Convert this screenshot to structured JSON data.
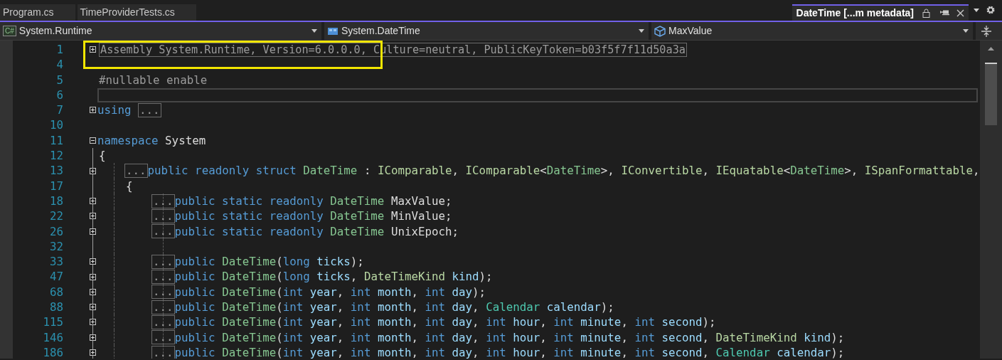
{
  "tabs": [
    {
      "label": "Program.cs",
      "selected": false,
      "kind": "document"
    },
    {
      "label": "TimeProviderTests.cs",
      "selected": false,
      "kind": "document"
    },
    {
      "label": "DateTime [...m metadata]",
      "selected": true,
      "kind": "preview"
    }
  ],
  "navigation": [
    {
      "label": "System.Runtime",
      "kind": "project",
      "badge": "C#"
    },
    {
      "label": "System.DateTime",
      "kind": "struct"
    },
    {
      "label": "MaxValue",
      "kind": "field"
    }
  ],
  "editor": {
    "lines": [
      {
        "number": "1",
        "expanded": false,
        "tokens": [
          {
            "kind": "collapsed",
            "text": "Assembly System.Runtime, Version=6.0.0.0, Culture=neutral, PublicKeyToken=b03f5f7f11d50a3a"
          }
        ]
      },
      {
        "number": "4"
      },
      {
        "number": "5",
        "tokens": [
          {
            "kind": "preproc",
            "text": "#nullable enable"
          }
        ]
      },
      {
        "number": "6",
        "current": true
      },
      {
        "number": "7",
        "expanded": false,
        "tokens": [
          {
            "kind": "kw",
            "text": "using "
          },
          {
            "kind": "collapsed",
            "text": "..."
          }
        ]
      },
      {
        "number": "10"
      },
      {
        "number": "11",
        "expanded": true,
        "tokens": [
          {
            "kind": "kw",
            "text": "namespace "
          },
          {
            "kind": "plain",
            "text": "System"
          }
        ]
      },
      {
        "number": "12",
        "tokens": [
          {
            "kind": "plain",
            "text": "{"
          }
        ],
        "children": [
          {
            "number": "13",
            "expanded": false,
            "tokens": [
              {
                "kind": "collapsed",
                "text": "..."
              },
              {
                "kind": "kw",
                "text": "public readonly struct "
              },
              {
                "kind": "struct",
                "text": "DateTime"
              },
              {
                "kind": "plain",
                "text": " : "
              },
              {
                "kind": "iface",
                "text": "IComparable"
              },
              {
                "kind": "plain",
                "text": ", "
              },
              {
                "kind": "iface",
                "text": "IComparable"
              },
              {
                "kind": "plain",
                "text": "<"
              },
              {
                "kind": "struct",
                "text": "DateTime"
              },
              {
                "kind": "plain",
                "text": ">, "
              },
              {
                "kind": "iface",
                "text": "IConvertible"
              },
              {
                "kind": "plain",
                "text": ", "
              },
              {
                "kind": "iface",
                "text": "IEquatable"
              },
              {
                "kind": "plain",
                "text": "<"
              },
              {
                "kind": "struct",
                "text": "DateTime"
              },
              {
                "kind": "plain",
                "text": ">, "
              },
              {
                "kind": "iface",
                "text": "ISpanFormattable"
              },
              {
                "kind": "plain",
                "text": ","
              }
            ]
          },
          {
            "number": "17",
            "tokens": [
              {
                "kind": "plain",
                "text": "{"
              }
            ],
            "children": [
              {
                "number": "18",
                "expanded": false,
                "tokens": [
                  {
                    "kind": "collapsed",
                    "text": "..."
                  },
                  {
                    "kind": "kw",
                    "text": "public static readonly "
                  },
                  {
                    "kind": "struct",
                    "text": "DateTime "
                  },
                  {
                    "kind": "member",
                    "text": "MaxValue;"
                  }
                ]
              },
              {
                "number": "22",
                "expanded": false,
                "tokens": [
                  {
                    "kind": "collapsed",
                    "text": "..."
                  },
                  {
                    "kind": "kw",
                    "text": "public static readonly "
                  },
                  {
                    "kind": "struct",
                    "text": "DateTime "
                  },
                  {
                    "kind": "member",
                    "text": "MinValue;"
                  }
                ]
              },
              {
                "number": "26",
                "expanded": false,
                "tokens": [
                  {
                    "kind": "collapsed",
                    "text": "..."
                  },
                  {
                    "kind": "kw",
                    "text": "public static readonly "
                  },
                  {
                    "kind": "struct",
                    "text": "DateTime "
                  },
                  {
                    "kind": "member",
                    "text": "UnixEpoch;"
                  }
                ]
              },
              {
                "number": "32"
              },
              {
                "number": "33",
                "expanded": false,
                "tokens": [
                  {
                    "kind": "collapsed",
                    "text": "..."
                  },
                  {
                    "kind": "kw",
                    "text": "public "
                  },
                  {
                    "kind": "struct",
                    "text": "DateTime"
                  },
                  {
                    "kind": "plain",
                    "text": "("
                  },
                  {
                    "kind": "kw",
                    "text": "long "
                  },
                  {
                    "kind": "param",
                    "text": "ticks"
                  },
                  {
                    "kind": "plain",
                    "text": ");"
                  }
                ]
              },
              {
                "number": "47",
                "expanded": false,
                "tokens": [
                  {
                    "kind": "collapsed",
                    "text": "..."
                  },
                  {
                    "kind": "kw",
                    "text": "public "
                  },
                  {
                    "kind": "struct",
                    "text": "DateTime"
                  },
                  {
                    "kind": "plain",
                    "text": "("
                  },
                  {
                    "kind": "kw",
                    "text": "long "
                  },
                  {
                    "kind": "param",
                    "text": "ticks"
                  },
                  {
                    "kind": "plain",
                    "text": ", "
                  },
                  {
                    "kind": "enum",
                    "text": "DateTimeKind "
                  },
                  {
                    "kind": "param",
                    "text": "kind"
                  },
                  {
                    "kind": "plain",
                    "text": ");"
                  }
                ]
              },
              {
                "number": "68",
                "expanded": false,
                "tokens": [
                  {
                    "kind": "collapsed",
                    "text": "..."
                  },
                  {
                    "kind": "kw",
                    "text": "public "
                  },
                  {
                    "kind": "struct",
                    "text": "DateTime"
                  },
                  {
                    "kind": "plain",
                    "text": "("
                  },
                  {
                    "kind": "kw",
                    "text": "int "
                  },
                  {
                    "kind": "param",
                    "text": "year"
                  },
                  {
                    "kind": "plain",
                    "text": ", "
                  },
                  {
                    "kind": "kw",
                    "text": "int "
                  },
                  {
                    "kind": "param",
                    "text": "month"
                  },
                  {
                    "kind": "plain",
                    "text": ", "
                  },
                  {
                    "kind": "kw",
                    "text": "int "
                  },
                  {
                    "kind": "param",
                    "text": "day"
                  },
                  {
                    "kind": "plain",
                    "text": ");"
                  }
                ]
              },
              {
                "number": "88",
                "expanded": false,
                "tokens": [
                  {
                    "kind": "collapsed",
                    "text": "..."
                  },
                  {
                    "kind": "kw",
                    "text": "public "
                  },
                  {
                    "kind": "struct",
                    "text": "DateTime"
                  },
                  {
                    "kind": "plain",
                    "text": "("
                  },
                  {
                    "kind": "kw",
                    "text": "int "
                  },
                  {
                    "kind": "param",
                    "text": "year"
                  },
                  {
                    "kind": "plain",
                    "text": ", "
                  },
                  {
                    "kind": "kw",
                    "text": "int "
                  },
                  {
                    "kind": "param",
                    "text": "month"
                  },
                  {
                    "kind": "plain",
                    "text": ", "
                  },
                  {
                    "kind": "kw",
                    "text": "int "
                  },
                  {
                    "kind": "param",
                    "text": "day"
                  },
                  {
                    "kind": "plain",
                    "text": ", "
                  },
                  {
                    "kind": "class",
                    "text": "Calendar "
                  },
                  {
                    "kind": "param",
                    "text": "calendar"
                  },
                  {
                    "kind": "plain",
                    "text": ");"
                  }
                ]
              },
              {
                "number": "115",
                "expanded": false,
                "tokens": [
                  {
                    "kind": "collapsed",
                    "text": "..."
                  },
                  {
                    "kind": "kw",
                    "text": "public "
                  },
                  {
                    "kind": "struct",
                    "text": "DateTime"
                  },
                  {
                    "kind": "plain",
                    "text": "("
                  },
                  {
                    "kind": "kw",
                    "text": "int "
                  },
                  {
                    "kind": "param",
                    "text": "year"
                  },
                  {
                    "kind": "plain",
                    "text": ", "
                  },
                  {
                    "kind": "kw",
                    "text": "int "
                  },
                  {
                    "kind": "param",
                    "text": "month"
                  },
                  {
                    "kind": "plain",
                    "text": ", "
                  },
                  {
                    "kind": "kw",
                    "text": "int "
                  },
                  {
                    "kind": "param",
                    "text": "day"
                  },
                  {
                    "kind": "plain",
                    "text": ", "
                  },
                  {
                    "kind": "kw",
                    "text": "int "
                  },
                  {
                    "kind": "param",
                    "text": "hour"
                  },
                  {
                    "kind": "plain",
                    "text": ", "
                  },
                  {
                    "kind": "kw",
                    "text": "int "
                  },
                  {
                    "kind": "param",
                    "text": "minute"
                  },
                  {
                    "kind": "plain",
                    "text": ", "
                  },
                  {
                    "kind": "kw",
                    "text": "int "
                  },
                  {
                    "kind": "param",
                    "text": "second"
                  },
                  {
                    "kind": "plain",
                    "text": ");"
                  }
                ]
              },
              {
                "number": "146",
                "expanded": false,
                "tokens": [
                  {
                    "kind": "collapsed",
                    "text": "..."
                  },
                  {
                    "kind": "kw",
                    "text": "public "
                  },
                  {
                    "kind": "struct",
                    "text": "DateTime"
                  },
                  {
                    "kind": "plain",
                    "text": "("
                  },
                  {
                    "kind": "kw",
                    "text": "int "
                  },
                  {
                    "kind": "param",
                    "text": "year"
                  },
                  {
                    "kind": "plain",
                    "text": ", "
                  },
                  {
                    "kind": "kw",
                    "text": "int "
                  },
                  {
                    "kind": "param",
                    "text": "month"
                  },
                  {
                    "kind": "plain",
                    "text": ", "
                  },
                  {
                    "kind": "kw",
                    "text": "int "
                  },
                  {
                    "kind": "param",
                    "text": "day"
                  },
                  {
                    "kind": "plain",
                    "text": ", "
                  },
                  {
                    "kind": "kw",
                    "text": "int "
                  },
                  {
                    "kind": "param",
                    "text": "hour"
                  },
                  {
                    "kind": "plain",
                    "text": ", "
                  },
                  {
                    "kind": "kw",
                    "text": "int "
                  },
                  {
                    "kind": "param",
                    "text": "minute"
                  },
                  {
                    "kind": "plain",
                    "text": ", "
                  },
                  {
                    "kind": "kw",
                    "text": "int "
                  },
                  {
                    "kind": "param",
                    "text": "second"
                  },
                  {
                    "kind": "plain",
                    "text": ", "
                  },
                  {
                    "kind": "enum",
                    "text": "DateTimeKind "
                  },
                  {
                    "kind": "param",
                    "text": "kind"
                  },
                  {
                    "kind": "plain",
                    "text": ");"
                  }
                ]
              },
              {
                "number": "186",
                "expanded": false,
                "tokens": [
                  {
                    "kind": "collapsed",
                    "text": "..."
                  },
                  {
                    "kind": "kw",
                    "text": "public "
                  },
                  {
                    "kind": "struct",
                    "text": "DateTime"
                  },
                  {
                    "kind": "plain",
                    "text": "("
                  },
                  {
                    "kind": "kw",
                    "text": "int "
                  },
                  {
                    "kind": "param",
                    "text": "year"
                  },
                  {
                    "kind": "plain",
                    "text": ", "
                  },
                  {
                    "kind": "kw",
                    "text": "int "
                  },
                  {
                    "kind": "param",
                    "text": "month"
                  },
                  {
                    "kind": "plain",
                    "text": ", "
                  },
                  {
                    "kind": "kw",
                    "text": "int "
                  },
                  {
                    "kind": "param",
                    "text": "day"
                  },
                  {
                    "kind": "plain",
                    "text": ", "
                  },
                  {
                    "kind": "kw",
                    "text": "int "
                  },
                  {
                    "kind": "param",
                    "text": "hour"
                  },
                  {
                    "kind": "plain",
                    "text": ", "
                  },
                  {
                    "kind": "kw",
                    "text": "int "
                  },
                  {
                    "kind": "param",
                    "text": "minute"
                  },
                  {
                    "kind": "plain",
                    "text": ", "
                  },
                  {
                    "kind": "kw",
                    "text": "int "
                  },
                  {
                    "kind": "param",
                    "text": "second"
                  },
                  {
                    "kind": "plain",
                    "text": ", "
                  },
                  {
                    "kind": "class",
                    "text": "Calendar "
                  },
                  {
                    "kind": "param",
                    "text": "calendar"
                  },
                  {
                    "kind": "plain",
                    "text": ");"
                  }
                ]
              }
            ]
          }
        ]
      }
    ]
  }
}
